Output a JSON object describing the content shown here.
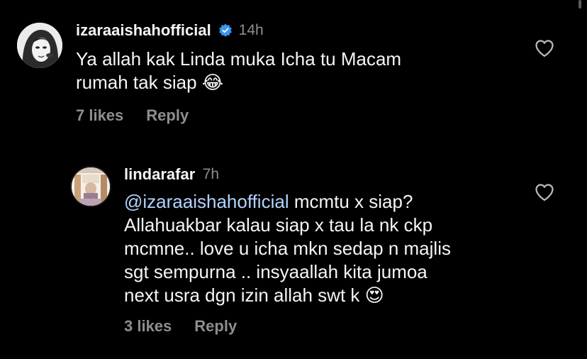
{
  "comments": [
    {
      "username": "izaraaishahofficial",
      "verified": true,
      "time": "14h",
      "text_lines": [
        "Ya allah kak Linda muka Icha tu Macam",
        "rumah tak siap"
      ],
      "emoji": "😂",
      "likes": "7 likes",
      "reply_label": "Reply"
    }
  ],
  "replies": [
    {
      "username": "lindarafar",
      "time": "7h",
      "mention": "@izaraaishahofficial",
      "text_first_line_rest": " mcmtu x siap?",
      "text_lines": [
        "Allahuakbar kalau siap x tau la nk ckp",
        "mcmne.. love u icha mkn sedap n majlis",
        "sgt sempurna .. insyaallah kita jumoa",
        "next usra dgn izin allah swt k"
      ],
      "emoji": "😍",
      "likes": "3 likes",
      "reply_label": "Reply"
    }
  ],
  "colors": {
    "background": "#000000",
    "text": "#f5f5f5",
    "muted": "#8e8e8e",
    "mention": "#b2d3ff",
    "verified": "#3897f0"
  }
}
